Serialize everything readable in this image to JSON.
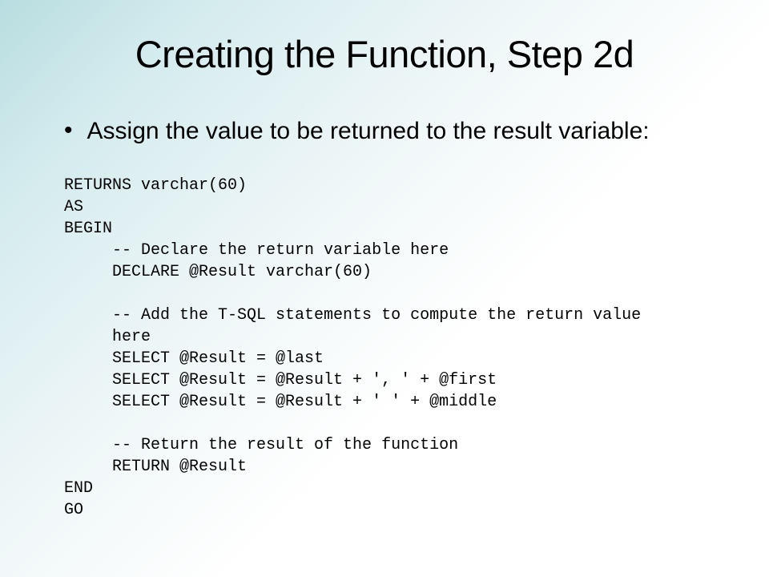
{
  "slide": {
    "title": "Creating the Function, Step 2d",
    "bullet_text": "Assign the value to be returned to the result variable:",
    "code_lines": {
      "l0": "RETURNS varchar(60)",
      "l1": "AS",
      "l2": "BEGIN",
      "l3": "     -- Declare the return variable here",
      "l4": "     DECLARE @Result varchar(60)",
      "l5": "",
      "l6": "     -- Add the T-SQL statements to compute the return value",
      "l7": "     here",
      "l8": "     SELECT @Result = @last",
      "l9": "     SELECT @Result = @Result + ', ' + @first",
      "l10": "     SELECT @Result = @Result + ' ' + @middle",
      "l11": "",
      "l12": "     -- Return the result of the function",
      "l13": "     RETURN @Result",
      "l14": "END",
      "l15": "GO"
    }
  }
}
